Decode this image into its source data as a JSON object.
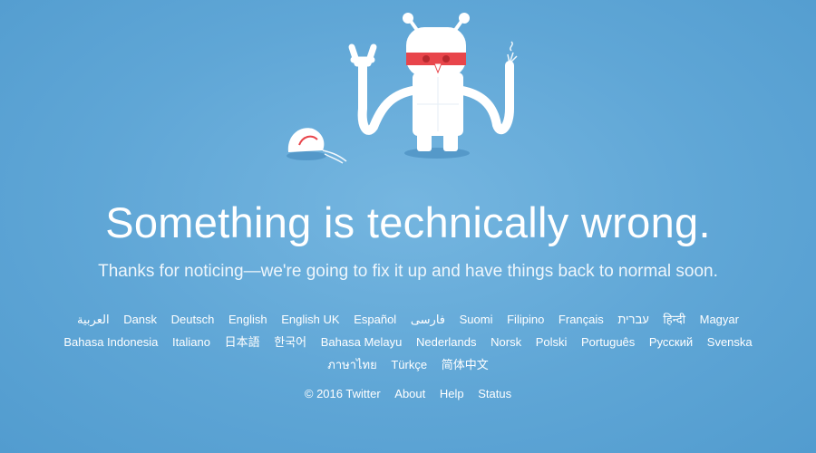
{
  "colors": {
    "background": "#5fa6d6",
    "text": "#ffffff",
    "robot_visor": "#e8454b",
    "robot_body": "#ffffff"
  },
  "illustration": {
    "icon": "broken-robot-illustration"
  },
  "error": {
    "headline": "Something is technically wrong.",
    "message": "Thanks for noticing—we're going to fix it up and have things back to normal soon."
  },
  "languages": [
    "العربية",
    "Dansk",
    "Deutsch",
    "English",
    "English UK",
    "Español",
    "فارسی",
    "Suomi",
    "Filipino",
    "Français",
    "עברית",
    "हिन्दी",
    "Magyar",
    "Bahasa Indonesia",
    "Italiano",
    "日本語",
    "한국어",
    "Bahasa Melayu",
    "Nederlands",
    "Norsk",
    "Polski",
    "Português",
    "Русский",
    "Svenska",
    "ภาษาไทย",
    "Türkçe",
    "简体中文"
  ],
  "footer": {
    "copyright": "© 2016 Twitter",
    "about": "About",
    "help": "Help",
    "status": "Status"
  }
}
